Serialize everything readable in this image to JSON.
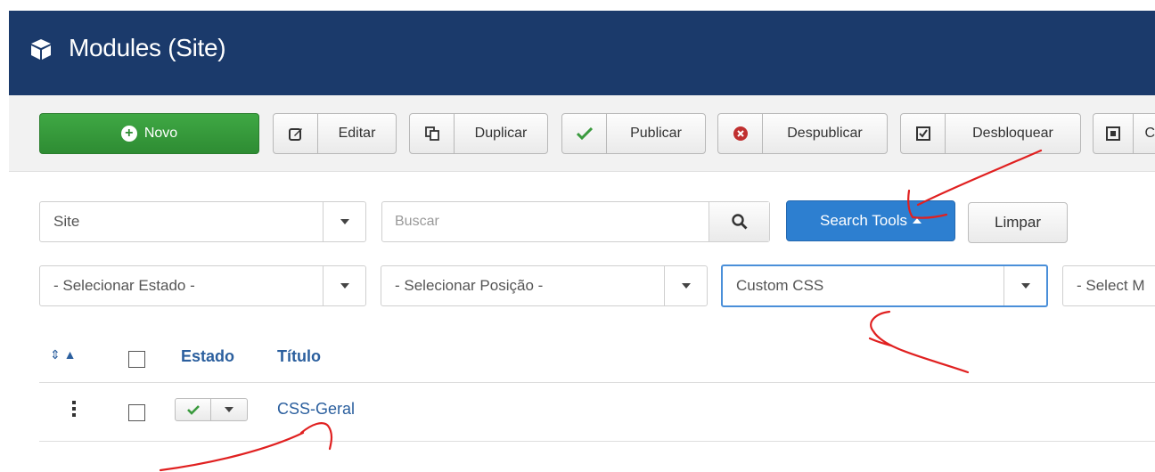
{
  "header": {
    "title": "Modules (Site)",
    "icon": "cube-icon"
  },
  "toolbar": {
    "new_label": "Novo",
    "edit_label": "Editar",
    "duplicate_label": "Duplicar",
    "publish_label": "Publicar",
    "unpublish_label": "Despublicar",
    "checkin_label": "Desbloquear",
    "next_label": "C"
  },
  "filters": {
    "client_value": "Site",
    "search_placeholder": "Buscar",
    "search_tools_label": "Search Tools",
    "clear_label": "Limpar",
    "state_value": "- Selecionar Estado -",
    "position_value": "- Selecionar Posição -",
    "module_value": "Custom CSS",
    "menu_value": "- Select M"
  },
  "table": {
    "headers": {
      "status": "Estado",
      "title": "Título"
    },
    "rows": [
      {
        "title": "CSS-Geral",
        "published": true
      }
    ]
  },
  "colors": {
    "header_bg": "#1b3a6b",
    "new_button": "#2e8c33",
    "search_tools": "#2d7fd0",
    "link": "#2b5f9e",
    "annotation": "#e02020"
  }
}
